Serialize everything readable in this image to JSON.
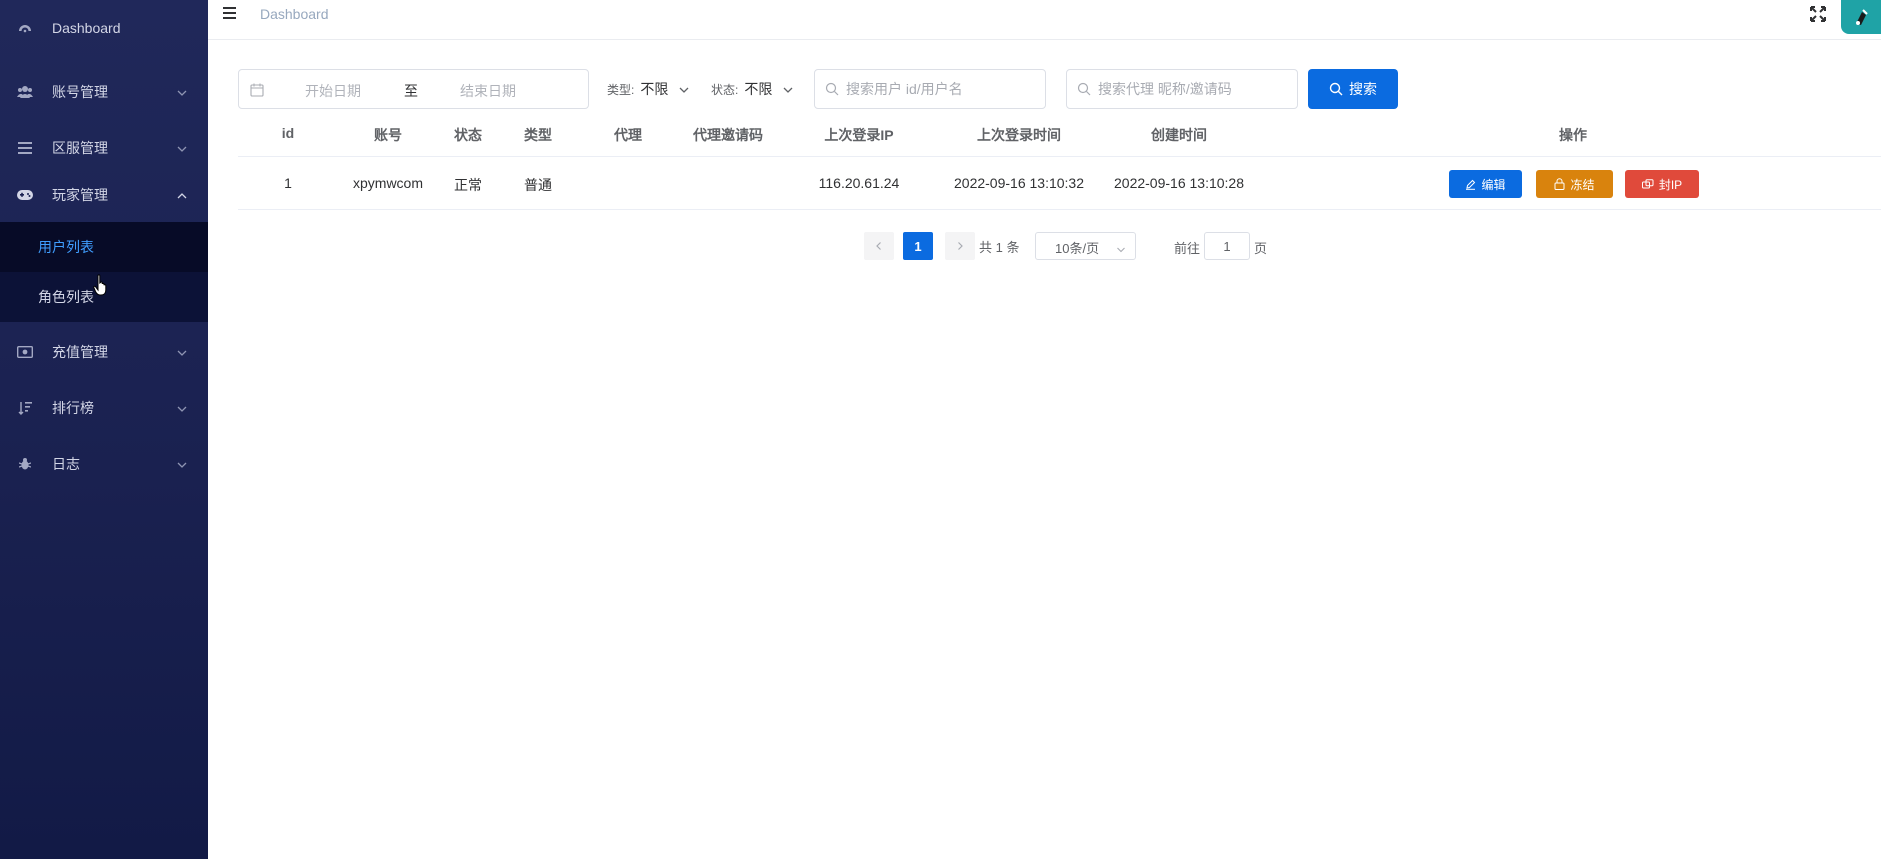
{
  "sidebar": {
    "items": [
      {
        "label": "Dashboard",
        "icon": "dashboard-icon"
      },
      {
        "label": "账号管理",
        "icon": "users-icon"
      },
      {
        "label": "区服管理",
        "icon": "server-list-icon"
      },
      {
        "label": "玩家管理",
        "icon": "gamepad-icon"
      },
      {
        "label": "充值管理",
        "icon": "money-icon"
      },
      {
        "label": "排行榜",
        "icon": "sort-icon"
      },
      {
        "label": "日志",
        "icon": "bug-icon"
      }
    ],
    "player_sub": [
      {
        "label": "用户列表"
      },
      {
        "label": "角色列表"
      }
    ]
  },
  "header": {
    "breadcrumb": "Dashboard"
  },
  "filters": {
    "date_start_placeholder": "开始日期",
    "date_separator": "至",
    "date_end_placeholder": "结束日期",
    "type_label": "类型:",
    "type_value": "不限",
    "status_label": "状态:",
    "status_value": "不限",
    "user_search_placeholder": "搜索用户 id/用户名",
    "agent_search_placeholder": "搜索代理 昵称/邀请码",
    "search_button": "搜索"
  },
  "table": {
    "columns": [
      "id",
      "账号",
      "状态",
      "类型",
      "代理",
      "代理邀请码",
      "上次登录IP",
      "上次登录时间",
      "创建时间",
      "操作"
    ],
    "rows": [
      {
        "id": "1",
        "account": "xpymwcom",
        "status": "正常",
        "type": "普通",
        "agent": "",
        "agent_code": "",
        "last_ip": "116.20.61.24",
        "last_login": "2022-09-16 13:10:32",
        "created": "2022-09-16 13:10:28"
      }
    ],
    "actions": {
      "edit": "编辑",
      "freeze": "冻结",
      "ban_ip": "封IP"
    }
  },
  "pagination": {
    "current_page": "1",
    "total": "共 1 条",
    "page_size": "10条/页",
    "goto_label": "前往",
    "goto_value": "1",
    "goto_unit": "页"
  },
  "colors": {
    "primary": "#0b6be0",
    "warning": "#d9830d",
    "danger": "#e04a3b",
    "sidebar_bg": "#1a2150",
    "active_menu_text": "#409eff"
  }
}
